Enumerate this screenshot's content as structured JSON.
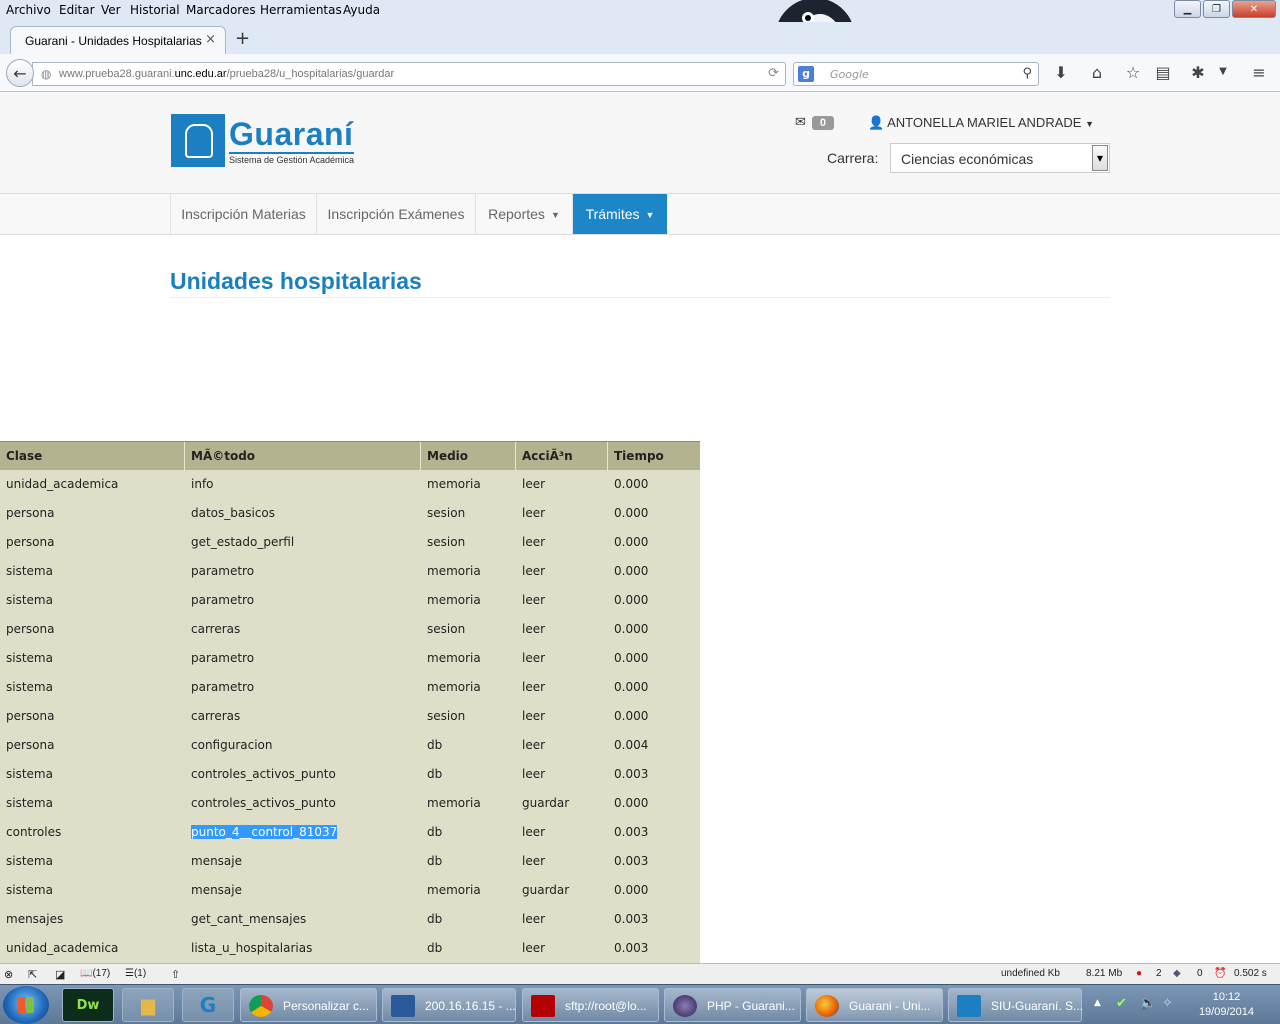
{
  "browser": {
    "menu": [
      "Archivo",
      "Editar",
      "Ver",
      "Historial",
      "Marcadores",
      "Herramientas",
      "Ayuda"
    ],
    "tab_title": "Guarani - Unidades Hospitalarias",
    "tab_close": "×",
    "new_tab": "+",
    "url_prefix": "www.prueba28.guarani.",
    "url_domain": "unc.edu.ar",
    "url_path": "/prueba28/u_hospitalarias/guardar",
    "search_placeholder": "Google"
  },
  "header": {
    "logo_name": "Guaraní",
    "logo_sub": "Sistema de Gestión Académica",
    "mail_count": "0",
    "user_name": "ANTONELLA MARIEL ANDRADE",
    "carrera_label": "Carrera:",
    "carrera_value": "Ciencias económicas"
  },
  "nav": {
    "items": [
      "Inscripción Materias",
      "Inscripción Exámenes",
      "Reportes",
      "Trámites"
    ]
  },
  "page": {
    "title": "Unidades hospitalarias"
  },
  "debug_table": {
    "columns": [
      "Clase",
      "MÃ©todo",
      "Medio",
      "AcciÃ³n",
      "Tiempo"
    ],
    "rows": [
      [
        "unidad_academica",
        "info",
        "memoria",
        "leer",
        "0.000"
      ],
      [
        "persona",
        "datos_basicos",
        "sesion",
        "leer",
        "0.000"
      ],
      [
        "persona",
        "get_estado_perfil",
        "sesion",
        "leer",
        "0.000"
      ],
      [
        "sistema",
        "parametro",
        "memoria",
        "leer",
        "0.000"
      ],
      [
        "sistema",
        "parametro",
        "memoria",
        "leer",
        "0.000"
      ],
      [
        "persona",
        "carreras",
        "sesion",
        "leer",
        "0.000"
      ],
      [
        "sistema",
        "parametro",
        "memoria",
        "leer",
        "0.000"
      ],
      [
        "sistema",
        "parametro",
        "memoria",
        "leer",
        "0.000"
      ],
      [
        "persona",
        "carreras",
        "sesion",
        "leer",
        "0.000"
      ],
      [
        "persona",
        "configuracion",
        "db",
        "leer",
        "0.004"
      ],
      [
        "sistema",
        "controles_activos_punto",
        "db",
        "leer",
        "0.003"
      ],
      [
        "sistema",
        "controles_activos_punto",
        "memoria",
        "guardar",
        "0.000"
      ],
      [
        "controles",
        "punto_4__control_81037",
        "db",
        "leer",
        "0.003"
      ],
      [
        "sistema",
        "mensaje",
        "db",
        "leer",
        "0.003"
      ],
      [
        "sistema",
        "mensaje",
        "memoria",
        "guardar",
        "0.000"
      ],
      [
        "mensajes",
        "get_cant_mensajes",
        "db",
        "leer",
        "0.003"
      ],
      [
        "unidad_academica",
        "lista_u_hospitalarias",
        "db",
        "leer",
        "0.003"
      ]
    ],
    "selected_row": 12
  },
  "statusbar": {
    "counter1": "(17)",
    "counter2": "(1)",
    "kb": "undefined Kb",
    "mem": "8.21 Mb",
    "errors": "2",
    "php": "0",
    "time": "0.502 s"
  },
  "taskbar": {
    "tasks": [
      "Personalizar c...",
      "200.16.16.15 - ...",
      "sftp://root@lo...",
      "PHP - Guarani...",
      "Guarani - Uni...",
      "SIU-Guaraní. S..."
    ],
    "time": "10:12",
    "date": "19/09/2014"
  }
}
